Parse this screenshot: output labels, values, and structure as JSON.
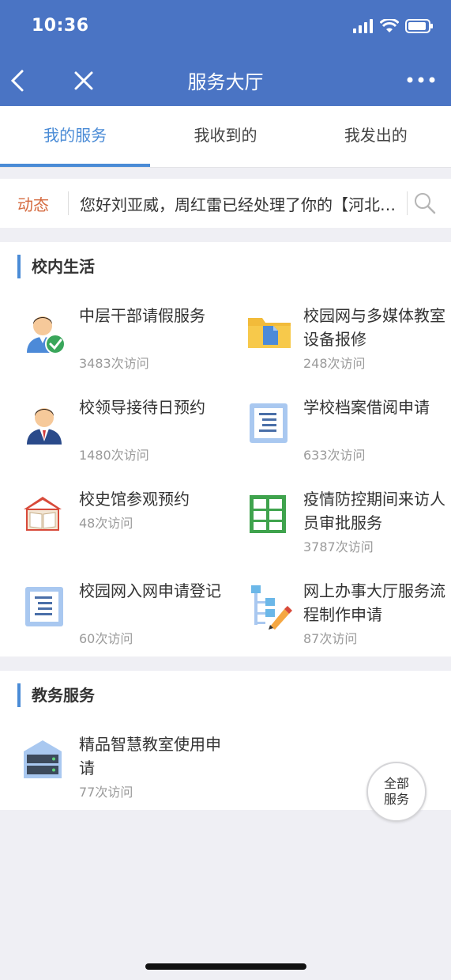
{
  "status": {
    "time": "10:36"
  },
  "nav": {
    "title": "服务大厅"
  },
  "tabs": [
    {
      "label": "我的服务",
      "active": true
    },
    {
      "label": "我收到的",
      "active": false
    },
    {
      "label": "我发出的",
      "active": false
    }
  ],
  "news": {
    "label": "动态",
    "text": "您好刘亚威，周红雷已经处理了你的【河北师范大学校园网入网申请】"
  },
  "sections": [
    {
      "title": "校内生活",
      "services": [
        {
          "name": "中层干部请假服务",
          "count": "3483次访问",
          "icon": "cadre-approved-icon"
        },
        {
          "name": "校园网与多媒体教室设备报修",
          "count": "248次访问",
          "icon": "folder-icon"
        },
        {
          "name": "校领导接待日预约",
          "count": "1480次访问",
          "icon": "leader-icon"
        },
        {
          "name": "学校档案借阅申请",
          "count": "633次访问",
          "icon": "document-icon"
        },
        {
          "name": "校史馆参观预约",
          "count": "48次访问",
          "icon": "museum-book-icon"
        },
        {
          "name": "疫情防控期间来访人员审批服务",
          "count": "3787次访问",
          "icon": "table-grid-icon"
        },
        {
          "name": "校园网入网申请登记",
          "count": "60次访问",
          "icon": "document-icon"
        },
        {
          "name": "网上办事大厅服务流程制作申请",
          "count": "87次访问",
          "icon": "flowchart-edit-icon"
        }
      ]
    },
    {
      "title": "教务服务",
      "services": [
        {
          "name": "精品智慧教室使用申请",
          "count": "77次访问",
          "icon": "server-icon"
        }
      ]
    }
  ],
  "all_services": {
    "line1": "全部",
    "line2": "服务"
  },
  "colors": {
    "header": "#4a74c4",
    "accent": "#4a8bd6",
    "news_label": "#d56b40"
  }
}
